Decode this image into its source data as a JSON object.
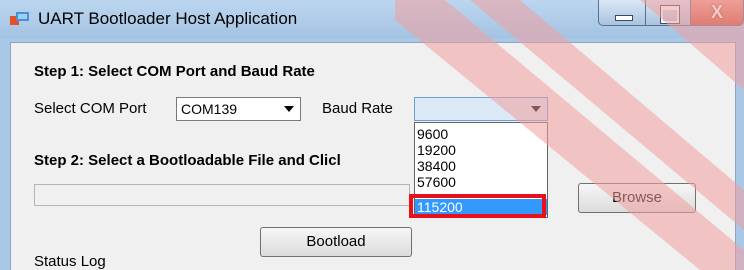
{
  "window": {
    "title": "UART Bootloader Host Application",
    "caption_buttons": [
      "minimize",
      "maximize",
      "close"
    ],
    "close_glyph": "X"
  },
  "step1": {
    "heading": "Step 1: Select COM Port and Baud Rate",
    "com_port_label": "Select COM Port",
    "com_port_value": "COM139",
    "baud_rate_label": "Baud Rate",
    "baud_rate_value": "",
    "baud_rate_options": [
      {
        "label": "9600",
        "selected": false
      },
      {
        "label": "19200",
        "selected": false
      },
      {
        "label": "38400",
        "selected": false
      },
      {
        "label": "57600",
        "selected": false
      },
      {
        "label": "115200",
        "selected": true
      }
    ]
  },
  "step2": {
    "heading": "Step 2: Select a Bootloadable File and Clicl",
    "file_path": "",
    "browse_label": "Browse"
  },
  "actions": {
    "bootload_label": "Bootload"
  },
  "status": {
    "label": "Status Log"
  },
  "colors": {
    "selection": "#3399ff",
    "highlight_box": "#e8101a",
    "watermark": "#f2a0a0"
  }
}
